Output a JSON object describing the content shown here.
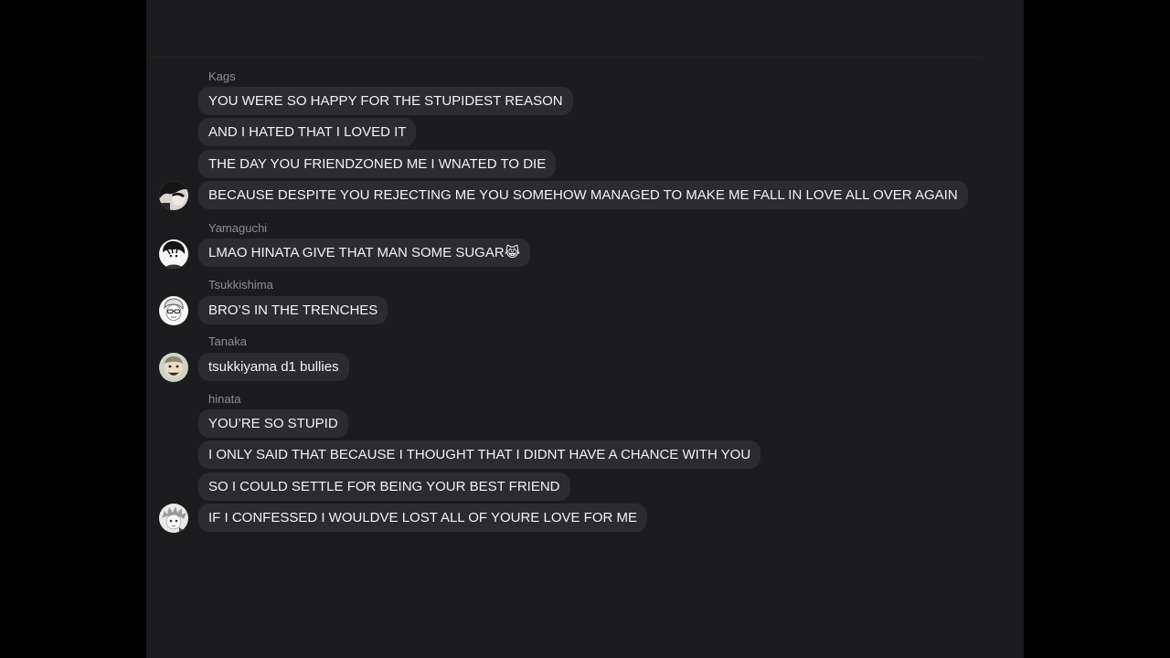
{
  "colors": {
    "background": "#000000",
    "chat_background": "#1c1c1e",
    "bubble": "#2c2c2e",
    "bubble_text": "#f2f2f7",
    "sender_name": "#8e8e93"
  },
  "groups": [
    {
      "sender": "Kags",
      "avatar_icon": "manga-avatar-icon-kags",
      "messages": [
        "YOU WERE SO HAPPY FOR THE STUPIDEST REASON",
        "AND I HATED THAT I LOVED IT",
        "THE DAY YOU FRIENDZONED ME I WNATED TO DIE",
        "BECAUSE DESPITE YOU REJECTING ME YOU SOMEHOW MANAGED TO MAKE ME FALL IN LOVE ALL OVER AGAIN"
      ]
    },
    {
      "sender": "Yamaguchi",
      "avatar_icon": "manga-avatar-icon-yamaguchi",
      "messages": [
        "LMAO HINATA GIVE THAT MAN SOME SUGAR😹"
      ]
    },
    {
      "sender": "Tsukkishima",
      "avatar_icon": "manga-avatar-icon-tsukkishima",
      "messages": [
        "BRO’S IN THE TRENCHES"
      ]
    },
    {
      "sender": "Tanaka",
      "avatar_icon": "manga-avatar-icon-tanaka",
      "messages": [
        "tsukkiyama d1 bullies"
      ]
    },
    {
      "sender": "hinata",
      "avatar_icon": "manga-avatar-icon-hinata",
      "messages": [
        "YOU’RE SO STUPID",
        "I ONLY SAID THAT BECAUSE I THOUGHT THAT I DIDNT HAVE A CHANCE WITH YOU",
        "SO I COULD SETTLE FOR BEING YOUR BEST FRIEND",
        "IF I CONFESSED I WOULDVE LOST ALL OF YOURE LOVE FOR ME"
      ]
    }
  ]
}
